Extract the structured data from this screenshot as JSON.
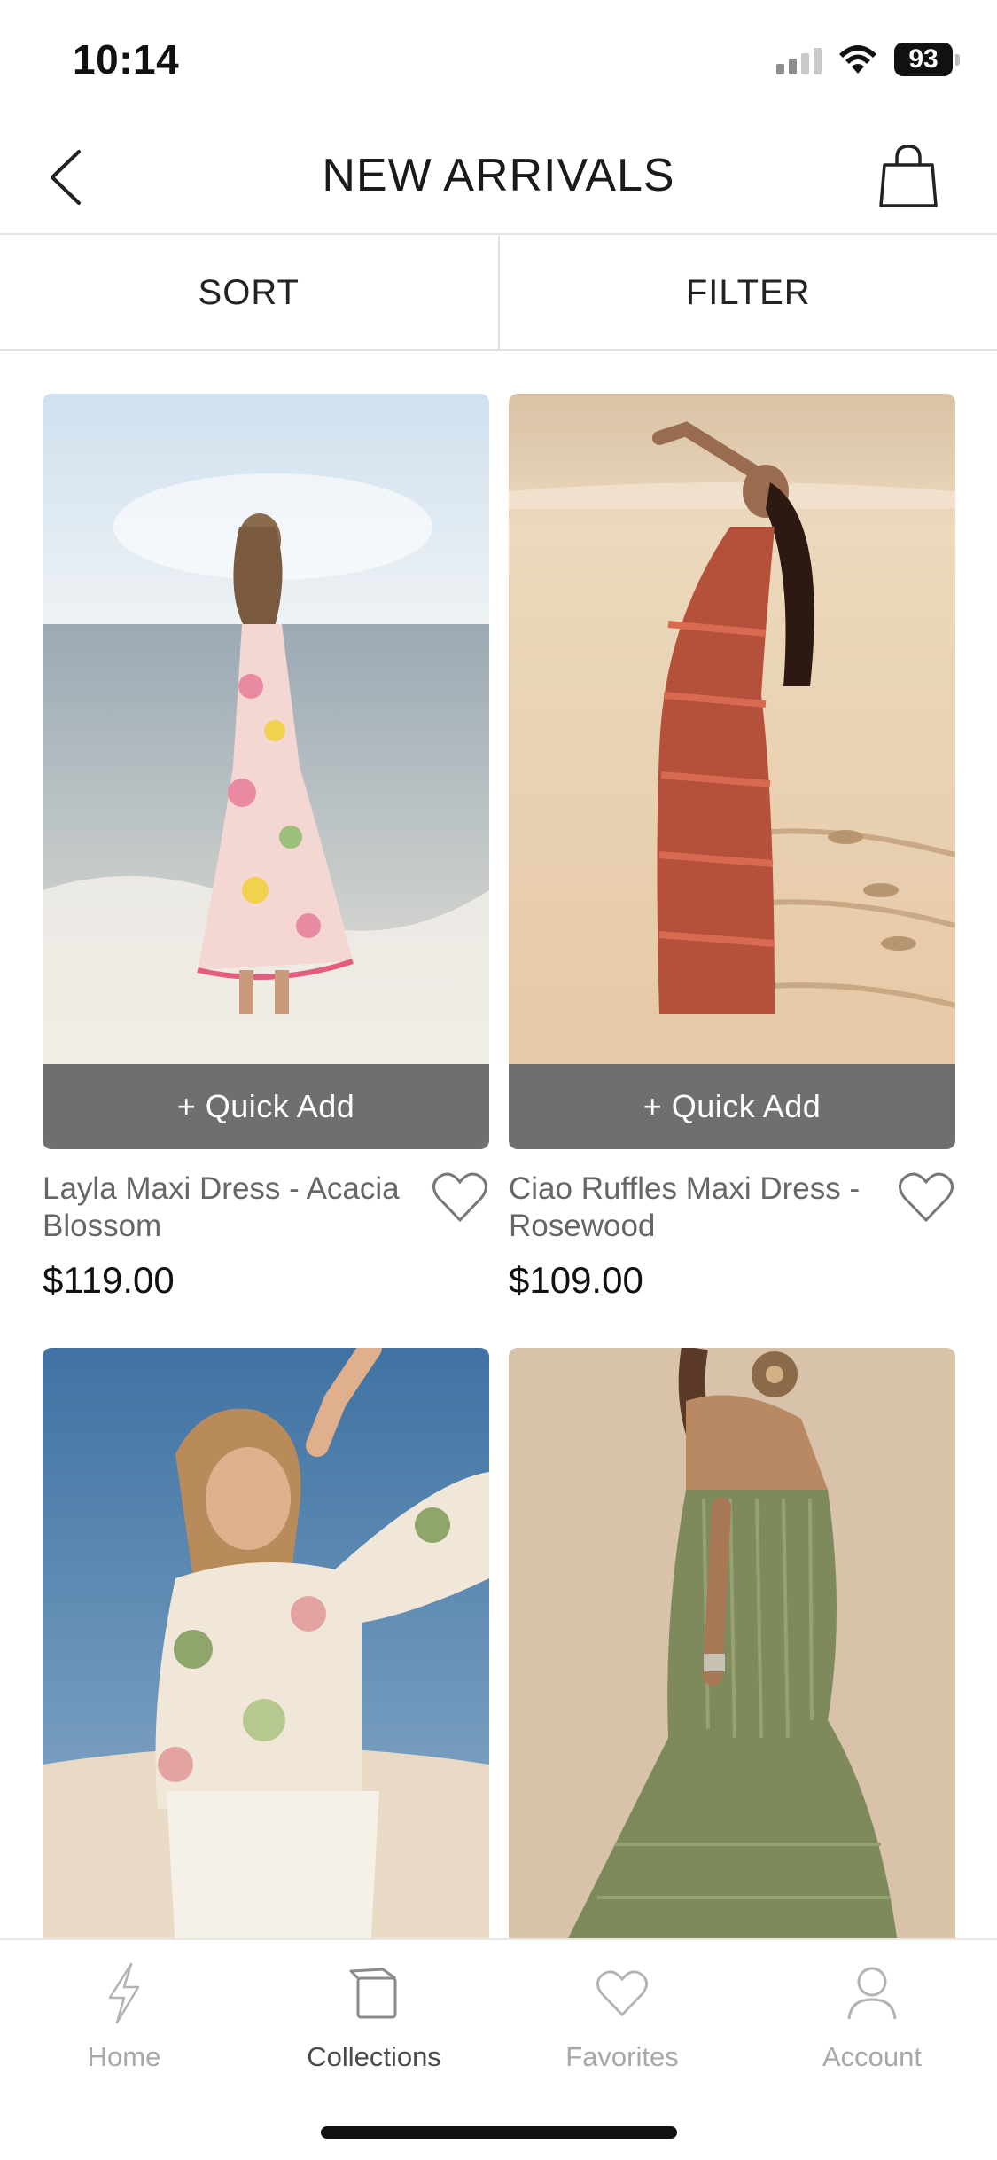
{
  "status": {
    "time": "10:14",
    "battery": "93"
  },
  "header": {
    "title": "NEW ARRIVALS"
  },
  "toolbar": {
    "sort_label": "SORT",
    "filter_label": "FILTER"
  },
  "products": [
    {
      "name": "Layla Maxi Dress - Acacia Blossom",
      "price": "$119.00",
      "quick_add": "+ Quick Add"
    },
    {
      "name": "Ciao Ruffles Maxi Dress - Rosewood",
      "price": "$109.00",
      "quick_add": "+ Quick Add"
    },
    {
      "name": "",
      "price": "",
      "quick_add": ""
    },
    {
      "name": "",
      "price": "",
      "quick_add": ""
    }
  ],
  "tabs": [
    {
      "label": "Home",
      "icon": "bolt-icon"
    },
    {
      "label": "Collections",
      "icon": "collections-icon"
    },
    {
      "label": "Favorites",
      "icon": "heart-icon"
    },
    {
      "label": "Account",
      "icon": "person-icon"
    }
  ],
  "active_tab": "Collections",
  "colors": {
    "quick_add_bg": "#6f6f6f",
    "divider": "#e2e2e2",
    "tab_inactive": "#a8a8a8"
  }
}
